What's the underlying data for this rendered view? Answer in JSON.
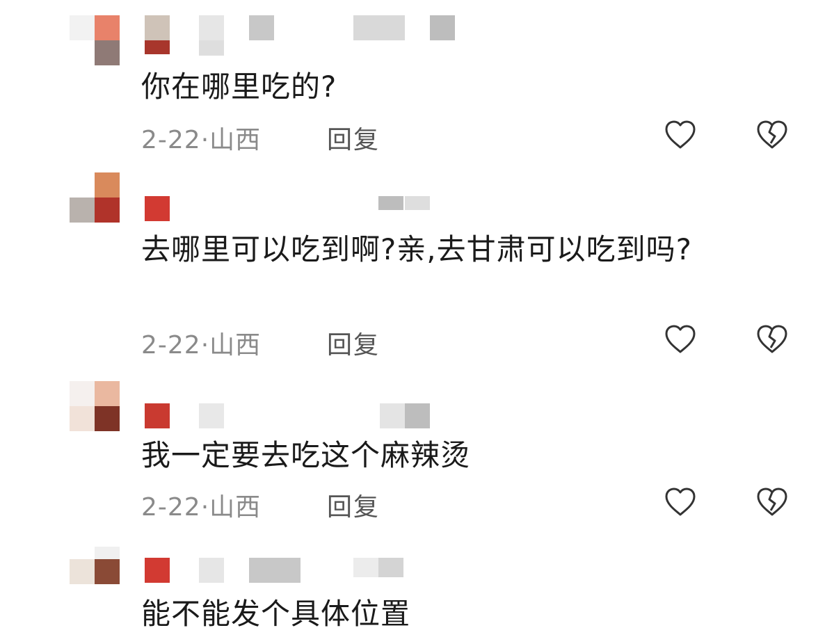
{
  "comments": [
    {
      "text": "你在哪里吃的?",
      "date": "2-22",
      "separator": "·",
      "location": "山西",
      "reply_label": "回复"
    },
    {
      "text": "去哪里可以吃到啊?亲,去甘肃可以吃到吗?",
      "date": "2-22",
      "separator": "·",
      "location": "山西",
      "reply_label": "回复"
    },
    {
      "text": "我一定要去吃这个麻辣烫",
      "date": "2-22",
      "separator": "·",
      "location": "山西",
      "reply_label": "回复"
    },
    {
      "text": "能不能发个具体位置"
    }
  ],
  "colors": {
    "text": "#1a1a1a",
    "meta": "#8a8a8a",
    "icon_stroke": "#333333",
    "avatar_red": "#c8302c",
    "avatar_orange": "#e8826a",
    "mosaic_gray": "#c9c9c9"
  },
  "icons": {
    "like": "heart-outline-icon",
    "dislike": "broken-heart-outline-icon"
  }
}
